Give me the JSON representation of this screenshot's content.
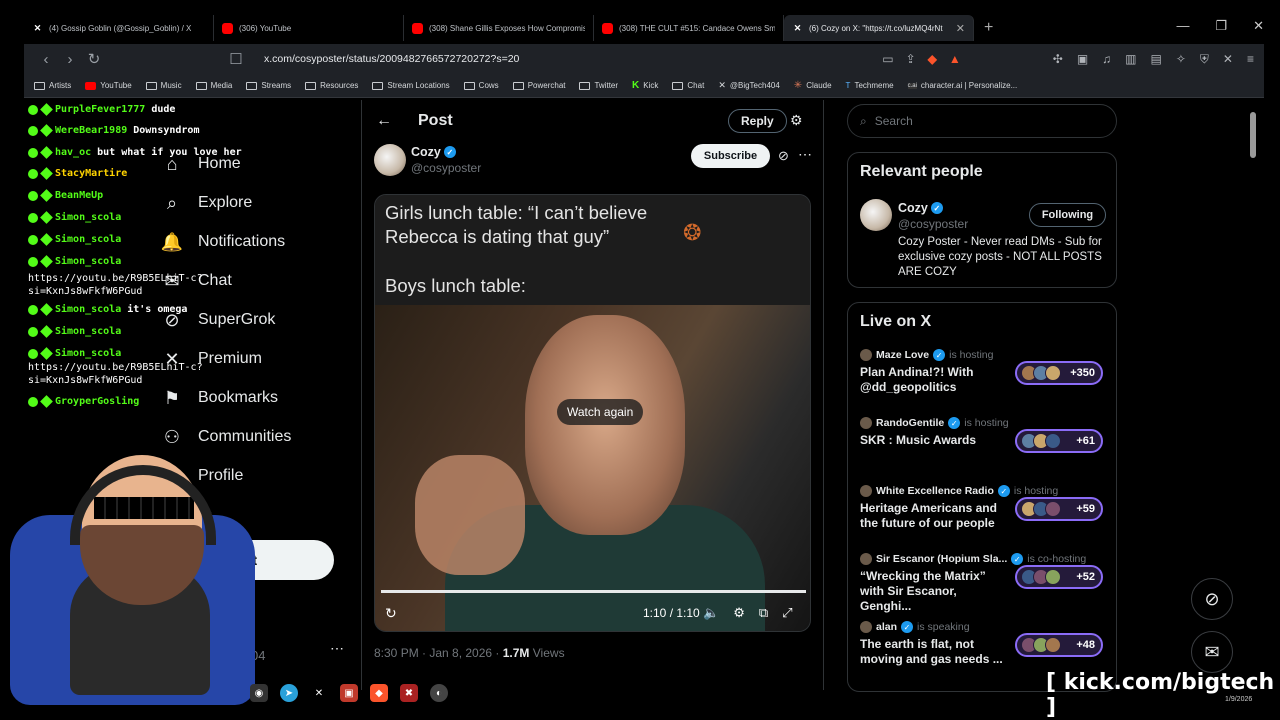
{
  "browser": {
    "tabs": [
      {
        "icon": "x",
        "label": "(4) Gossip Goblin (@Gossip_Goblin) / X"
      },
      {
        "icon": "yt",
        "label": "(306) YouTube"
      },
      {
        "icon": "yt",
        "label": "(308) Shane Gillis Exposes How Compromise"
      },
      {
        "icon": "yt",
        "label": "(308) THE CULT #515: Candace Owens Smac"
      },
      {
        "icon": "x",
        "label": "(6) Cozy on X: \"https://t.co/luzMQ4rNt"
      }
    ],
    "url": "x.com/cosyposter/status/2009482766572720272?s=20",
    "bookmarks": [
      {
        "type": "folder",
        "label": "Artists"
      },
      {
        "type": "yt",
        "label": "YouTube"
      },
      {
        "type": "folder",
        "label": "Music"
      },
      {
        "type": "folder",
        "label": "Media"
      },
      {
        "type": "folder",
        "label": "Streams"
      },
      {
        "type": "folder",
        "label": "Resources"
      },
      {
        "type": "folder",
        "label": "Stream Locations"
      },
      {
        "type": "folder",
        "label": "Cows"
      },
      {
        "type": "folder",
        "label": "Powerchat"
      },
      {
        "type": "folder",
        "label": "Twitter"
      },
      {
        "type": "kick",
        "label": "Kick"
      },
      {
        "type": "folder",
        "label": "Chat"
      },
      {
        "type": "x",
        "label": "@BigTech404"
      },
      {
        "type": "claude",
        "label": "Claude"
      },
      {
        "type": "tm",
        "label": "Techmeme"
      },
      {
        "type": "cai",
        "label": "character.ai | Personalize..."
      }
    ]
  },
  "nav": {
    "items": [
      {
        "icon": "home-icon",
        "glyph": "⌂",
        "label": "Home"
      },
      {
        "icon": "search-icon",
        "glyph": "⌕",
        "label": "Explore"
      },
      {
        "icon": "bell-icon",
        "glyph": "🔔",
        "label": "Notifications"
      },
      {
        "icon": "chat-icon",
        "glyph": "✉",
        "label": "Chat"
      },
      {
        "icon": "grok-icon",
        "glyph": "⊘",
        "label": "SuperGrok"
      },
      {
        "icon": "x-icon",
        "glyph": "✕",
        "label": "Premium"
      },
      {
        "icon": "bookmark-icon",
        "glyph": "⚑",
        "label": "Bookmarks"
      },
      {
        "icon": "communities-icon",
        "glyph": "⚇",
        "label": "Communities"
      },
      {
        "icon": "profile-icon",
        "glyph": "◯",
        "label": "Profile"
      },
      {
        "icon": "more-icon",
        "glyph": "⋯",
        "label": "re"
      }
    ],
    "post_label": "Post",
    "account_handle": "ch404"
  },
  "post": {
    "header_title": "Post",
    "reply_label": "Reply",
    "author_name": "Cozy",
    "author_handle": "@cosyposter",
    "subscribe_label": "Subscribe",
    "meme_line1": "Girls lunch table: “I can’t believe Rebecca is dating that guy”",
    "meme_line2": "Boys lunch table:",
    "watch_again": "Watch again",
    "video_time": "1:10 / 1:10",
    "progress": 1.0,
    "timestamp": "8:30 PM · Jan 8, 2026 · ",
    "views_count": "1.7M",
    "views_label": " Views"
  },
  "right": {
    "search_placeholder": "Search",
    "relevant_title": "Relevant people",
    "person_name": "Cozy",
    "person_handle": "@cosyposter",
    "following_label": "Following",
    "person_bio": "Cozy Poster - Never read DMs - Sub for exclusive cozy posts - NOT ALL POSTS ARE COZY",
    "live_title": "Live on X",
    "live": [
      {
        "host": "Maze Love",
        "status": "is hosting",
        "title": "Plan Andina!?! With @dd_geopolitics",
        "count": "+350"
      },
      {
        "host": "RandoGentile",
        "status": "is hosting",
        "title": "SKR : Music Awards",
        "count": "+61"
      },
      {
        "host": "White Excellence Radio",
        "status": "is hosting",
        "title": "Heritage Americans and the future of our people",
        "count": "+59"
      },
      {
        "host": "Sir Escanor (Hopium Sla...",
        "status": "is co-hosting",
        "title": "“Wrecking the Matrix” with Sir Escanor, Genghi...",
        "count": "+52"
      },
      {
        "host": "alan",
        "status": "is speaking",
        "title": "The earth is flat, not moving and gas needs ...",
        "count": "+48"
      }
    ]
  },
  "chat": [
    {
      "user": "PurpleFever1777",
      "msg": "dude",
      "gold": false
    },
    {
      "user": "WereBear1989",
      "msg": "Downsyndrom",
      "gold": false
    },
    {
      "user": "hav_oc",
      "msg": "but what if you love her",
      "gold": false
    },
    {
      "user": "StacyMartire",
      "msg": "",
      "gold": true
    },
    {
      "user": "BeanMeUp",
      "msg": "",
      "gold": false
    },
    {
      "user": "Simon_scola",
      "msg": "",
      "gold": false
    },
    {
      "user": "Simon_scola",
      "msg": "",
      "gold": false
    },
    {
      "user": "Simon_scola",
      "msg": "",
      "gold": false
    },
    {
      "user": "",
      "msg": "https://youtu.be/R9B5ELhiT-c?",
      "gold": false
    },
    {
      "user": "",
      "msg": "si=KxnJs8wFkfW6PGud",
      "gold": false
    },
    {
      "user": "Simon_scola",
      "msg": "it's omega",
      "gold": false
    },
    {
      "user": "Simon_scola",
      "msg": "",
      "gold": false
    },
    {
      "user": "Simon_scola",
      "msg": "",
      "gold": false
    },
    {
      "user": "",
      "msg": "https://youtu.be/R9B5ELhiT-c?",
      "gold": false
    },
    {
      "user": "",
      "msg": "si=KxnJs8wFkfW6PGud",
      "gold": false
    },
    {
      "user": "GroyperGosling",
      "msg": "",
      "gold": false
    }
  ],
  "overlay": {
    "kick_url": "[ kick.com/bigtech ]",
    "clock_date": "1/9/2026"
  }
}
